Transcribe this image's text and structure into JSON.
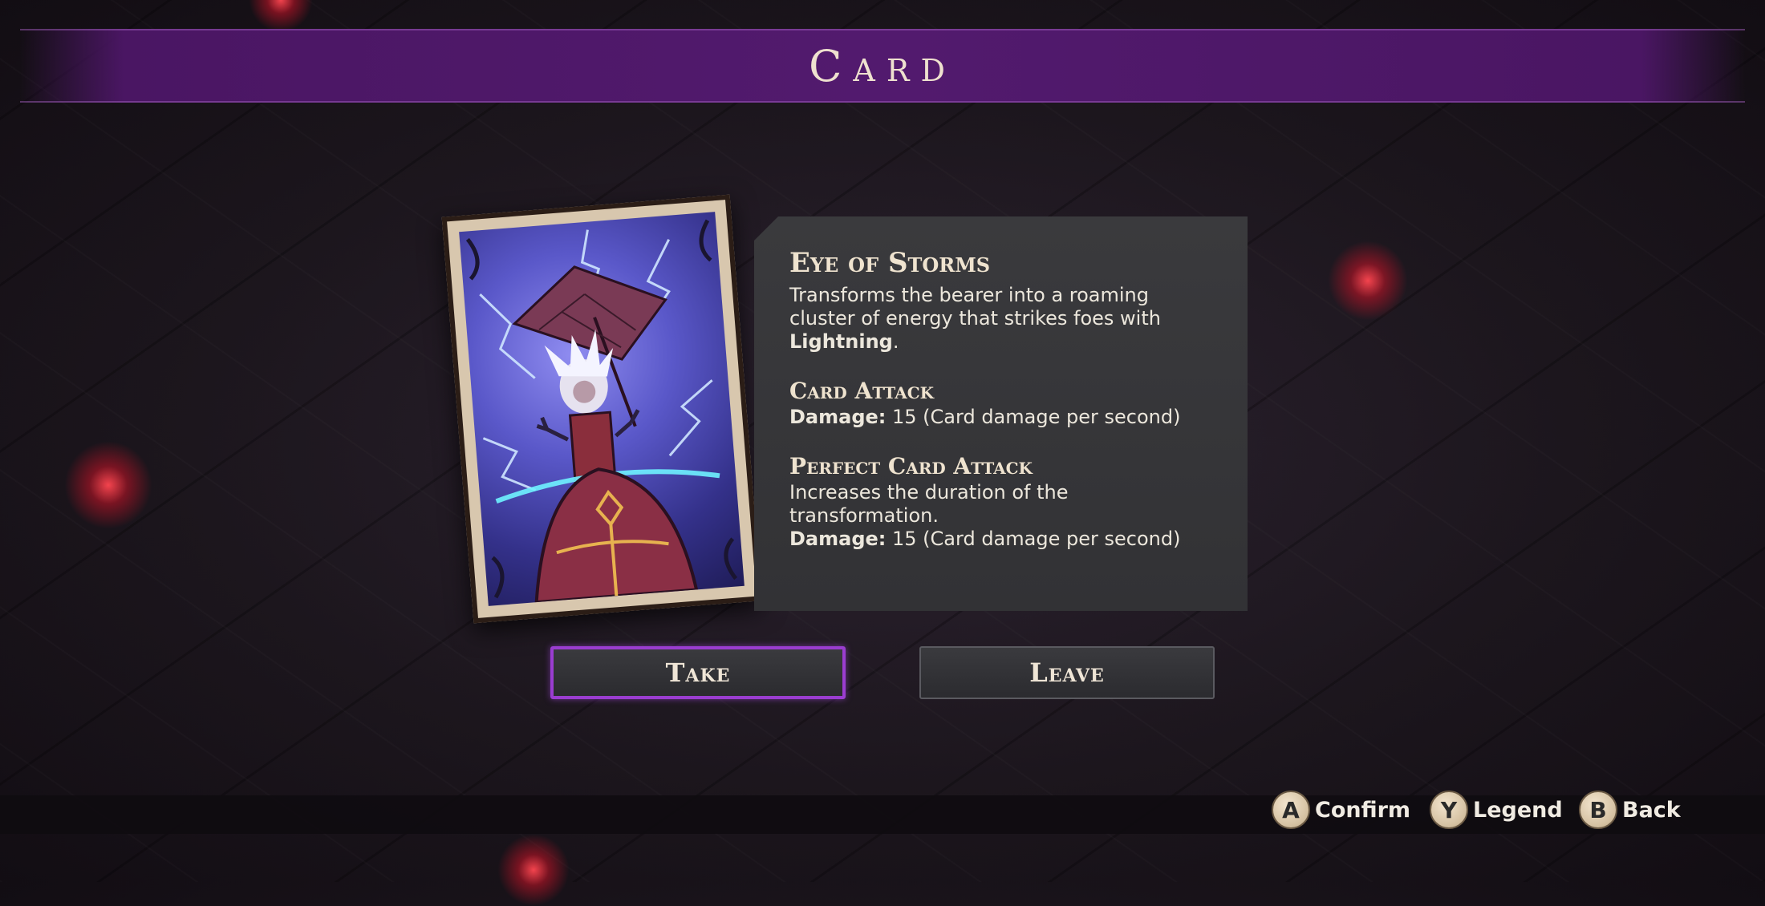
{
  "header": {
    "title": "Card"
  },
  "card": {
    "name": "Eye of Storms",
    "description_lines": [
      "Transforms the bearer into a roaming",
      "cluster of energy that strikes foes with"
    ],
    "description_keyword": "Lightning",
    "description_end": ".",
    "sections": [
      {
        "title": "Card Attack",
        "text_lines": [],
        "damage_label": "Damage:",
        "damage_value": "15 (Card damage per second)"
      },
      {
        "title": "Perfect Card Attack",
        "text_lines": [
          "Increases the duration of the",
          "transformation."
        ],
        "damage_label": "Damage:",
        "damage_value": "15 (Card damage per second)"
      }
    ]
  },
  "actions": {
    "take_label": "Take",
    "leave_label": "Leave"
  },
  "hints": [
    {
      "key": "A",
      "label": "Confirm"
    },
    {
      "key": "Y",
      "label": "Legend"
    },
    {
      "key": "B",
      "label": "Back"
    }
  ],
  "colors": {
    "banner": "#521a6e",
    "selected_outline": "#9a3dd0",
    "panel": "#3a3a3d",
    "text": "#ece7dc"
  }
}
